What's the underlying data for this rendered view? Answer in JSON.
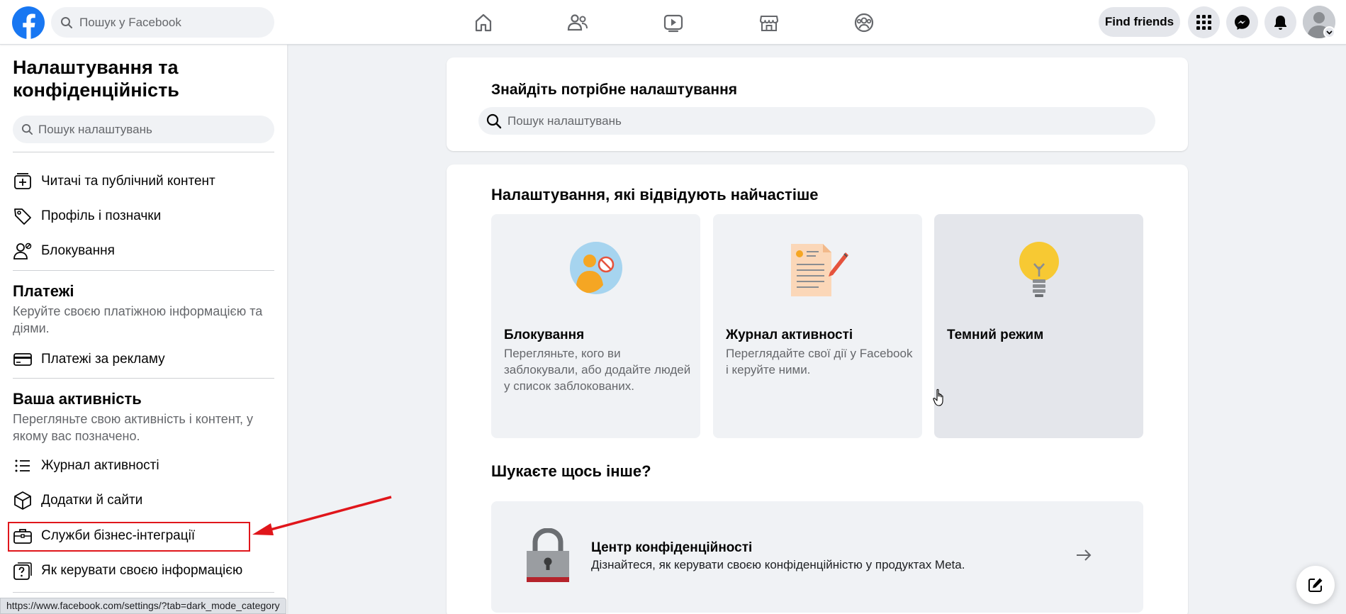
{
  "topbar": {
    "search_placeholder": "Пошук у Facebook",
    "find_friends": "Find friends"
  },
  "sidebar": {
    "title": "Налаштування та конфіденційність",
    "search_placeholder": "Пошук налаштувань",
    "items_top": [
      {
        "label": "Читачі та публічний контент",
        "icon": "add-box-icon"
      },
      {
        "label": "Профіль і позначки",
        "icon": "tag-icon"
      },
      {
        "label": "Блокування",
        "icon": "person-block-icon"
      }
    ],
    "payments": {
      "heading": "Платежі",
      "description": "Керуйте своєю платіжною інформацією та діями.",
      "items": [
        {
          "label": "Платежі за рекламу",
          "icon": "credit-card-icon"
        }
      ]
    },
    "activity": {
      "heading": "Ваша активність",
      "description": "Перегляньте свою активність і контент, у якому вас позначено.",
      "items": [
        {
          "label": "Журнал активності",
          "icon": "list-icon"
        },
        {
          "label": "Додатки й сайти",
          "icon": "cube-icon"
        },
        {
          "label": "Служби бізнес-інтеграції",
          "icon": "briefcase-icon"
        },
        {
          "label": "Як керувати своєю інформацією",
          "icon": "question-box-icon"
        }
      ]
    }
  },
  "main": {
    "find_setting": {
      "title": "Знайдіть потрібне налаштування",
      "search_placeholder": "Пошук налаштувань"
    },
    "popular": {
      "title": "Налаштування, які відвідують найчастіше",
      "tiles": [
        {
          "title": "Блокування",
          "description": "Перегляньте, кого ви заблокували, або додайте людей у список заблокованих."
        },
        {
          "title": "Журнал активності",
          "description": "Переглядайте свої дії у Facebook і керуйте ними."
        },
        {
          "title": "Темний режим",
          "description": ""
        }
      ]
    },
    "other": {
      "title": "Шукаєте щось інше?",
      "privacy_center": {
        "title": "Центр конфіденційності",
        "description": "Дізнайтеся, як керувати своєю конфіденційністю у продуктах Meta."
      }
    }
  },
  "status_bar": {
    "url": "https://www.facebook.com/settings/?tab=dark_mode_category"
  },
  "colors": {
    "brand": "#1877f2",
    "highlight": "#e0161b"
  }
}
